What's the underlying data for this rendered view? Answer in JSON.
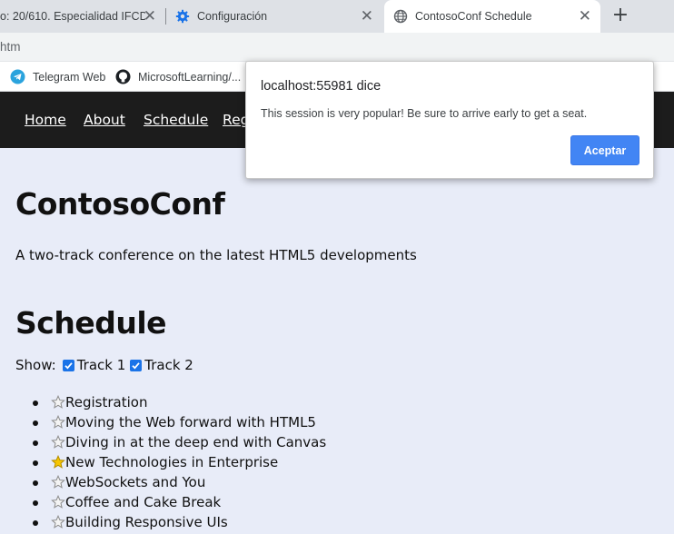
{
  "browser": {
    "tabs": [
      {
        "title": "o: 20/610. Especialidad IFCD",
        "active": false
      },
      {
        "title": "Configuración",
        "active": false
      },
      {
        "title": "ContosoConf Schedule",
        "active": true
      }
    ],
    "url": "htm",
    "bookmarks": [
      {
        "label": "Telegram Web",
        "icon": "telegram-icon"
      },
      {
        "label": "MicrosoftLearning/...",
        "icon": "github-icon"
      }
    ],
    "colors": {
      "accent": "#1a73e8",
      "tab_bar": "#dee1e6"
    }
  },
  "nav": {
    "items": [
      "Home",
      "About",
      "Schedule",
      "Reg"
    ],
    "background": "#1c1c1c"
  },
  "main": {
    "title": "ContosoConf",
    "tagline": "A two-track conference on the latest HTML5 developments",
    "schedule_title": "Schedule",
    "show_label": "Show:",
    "tracks": [
      {
        "label": "Track 1",
        "checked": true
      },
      {
        "label": "Track 2",
        "checked": true
      }
    ],
    "sessions": [
      {
        "title": "Registration",
        "starred": false
      },
      {
        "title": "Moving the Web forward with HTML5",
        "starred": false
      },
      {
        "title": "Diving in at the deep end with Canvas",
        "starred": false
      },
      {
        "title": "New Technologies in Enterprise",
        "starred": true
      },
      {
        "title": "WebSockets and You",
        "starred": false
      },
      {
        "title": "Coffee and Cake Break",
        "starred": false
      },
      {
        "title": "Building Responsive UIs",
        "starred": false
      }
    ]
  },
  "dialog": {
    "title": "localhost:55981 dice",
    "message": "This session is very popular! Be sure to arrive early to get a seat.",
    "button_label": "Aceptar",
    "button_color": "#4285f4"
  }
}
